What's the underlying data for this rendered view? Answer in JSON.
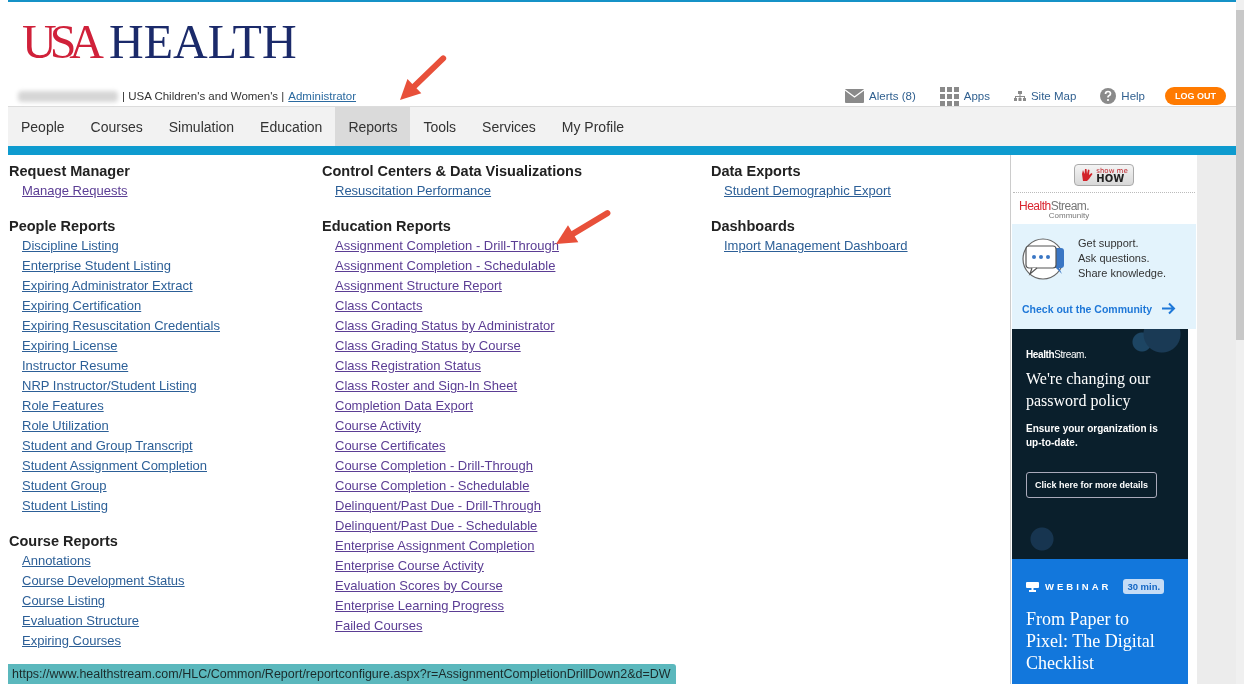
{
  "header": {
    "logo": {
      "mark": "USA",
      "word": "HEALTH"
    },
    "org_text": "| USA Children's and Women's |",
    "role_link": "Administrator",
    "utility_links": [
      {
        "kind": "alerts",
        "label": "Alerts (8)"
      },
      {
        "kind": "apps",
        "label": "Apps"
      },
      {
        "kind": "sitemap",
        "label": "Site Map"
      },
      {
        "kind": "help",
        "label": "Help"
      }
    ],
    "logout": "LOG OUT"
  },
  "nav": [
    {
      "label": "People",
      "selected": false
    },
    {
      "label": "Courses",
      "selected": false
    },
    {
      "label": "Simulation",
      "selected": false
    },
    {
      "label": "Education",
      "selected": false
    },
    {
      "label": "Reports",
      "selected": true
    },
    {
      "label": "Tools",
      "selected": false
    },
    {
      "label": "Services",
      "selected": false
    },
    {
      "label": "My Profile",
      "selected": false
    }
  ],
  "columns": [
    [
      {
        "heading": "Request Manager",
        "links": [
          {
            "label": "Manage Requests",
            "visited": true
          }
        ]
      },
      {
        "heading": "People Reports",
        "links": [
          {
            "label": "Discipline Listing",
            "visited": false
          },
          {
            "label": "Enterprise Student Listing",
            "visited": false
          },
          {
            "label": "Expiring Administrator Extract",
            "visited": false
          },
          {
            "label": "Expiring Certification",
            "visited": false
          },
          {
            "label": "Expiring Resuscitation Credentials",
            "visited": false
          },
          {
            "label": "Expiring License",
            "visited": false
          },
          {
            "label": "Instructor Resume",
            "visited": false
          },
          {
            "label": "NRP Instructor/Student Listing",
            "visited": false
          },
          {
            "label": "Role Features",
            "visited": false
          },
          {
            "label": "Role Utilization",
            "visited": false
          },
          {
            "label": "Student and Group Transcript",
            "visited": false
          },
          {
            "label": "Student Assignment Completion",
            "visited": false
          },
          {
            "label": "Student Group",
            "visited": false
          },
          {
            "label": "Student Listing",
            "visited": false
          }
        ]
      },
      {
        "heading": "Course Reports",
        "links": [
          {
            "label": "Annotations",
            "visited": false
          },
          {
            "label": "Course Development Status",
            "visited": false
          },
          {
            "label": "Course Listing",
            "visited": false
          },
          {
            "label": "Evaluation Structure",
            "visited": false
          },
          {
            "label": "Expiring Courses",
            "visited": false
          }
        ]
      }
    ],
    [
      {
        "heading": "Control Centers & Data Visualizations",
        "links": [
          {
            "label": "Resuscitation Performance",
            "visited": false
          }
        ]
      },
      {
        "heading": "Education Reports",
        "links": [
          {
            "label": "Assignment Completion - Drill-Through",
            "visited": true
          },
          {
            "label": "Assignment Completion - Schedulable",
            "visited": true
          },
          {
            "label": "Assignment Structure Report",
            "visited": true
          },
          {
            "label": "Class Contacts",
            "visited": true
          },
          {
            "label": "Class Grading Status by Administrator",
            "visited": true
          },
          {
            "label": "Class Grading Status by Course",
            "visited": true
          },
          {
            "label": "Class Registration Status",
            "visited": true
          },
          {
            "label": "Class Roster and Sign-In Sheet",
            "visited": true
          },
          {
            "label": "Completion Data Export",
            "visited": true
          },
          {
            "label": "Course Activity",
            "visited": true
          },
          {
            "label": "Course Certificates",
            "visited": true
          },
          {
            "label": "Course Completion - Drill-Through",
            "visited": true
          },
          {
            "label": "Course Completion - Schedulable",
            "visited": true
          },
          {
            "label": "Delinquent/Past Due - Drill-Through",
            "visited": true
          },
          {
            "label": "Delinquent/Past Due - Schedulable",
            "visited": true
          },
          {
            "label": "Enterprise Assignment Completion",
            "visited": true
          },
          {
            "label": "Enterprise Course Activity",
            "visited": true
          },
          {
            "label": "Evaluation Scores by Course",
            "visited": true
          },
          {
            "label": "Enterprise Learning Progress",
            "visited": true
          },
          {
            "label": "Failed Courses",
            "visited": true
          }
        ]
      }
    ],
    [
      {
        "heading": "Data Exports",
        "links": [
          {
            "label": "Student Demographic Export",
            "visited": false
          }
        ]
      },
      {
        "heading": "Dashboards",
        "links": [
          {
            "label": "Import Management Dashboard",
            "visited": false
          }
        ]
      }
    ]
  ],
  "sidebar": {
    "show_me_how": {
      "top": "show me",
      "bottom": "HOW"
    },
    "community": {
      "brand_a": "Health",
      "brand_b": "Stream.",
      "sub": "Community",
      "lines": [
        "Get support.",
        "Ask questions.",
        "Share knowledge."
      ],
      "link": "Check out the Community"
    },
    "password_card": {
      "brand_a": "Health",
      "brand_b": "Stream.",
      "title": "We're changing our password policy",
      "text": "Ensure your organization is up-to-date.",
      "button": "Click here for more details"
    },
    "webinar_card": {
      "tag": "WEBINAR",
      "duration": "30 min.",
      "title": "From Paper to Pixel: The Digital Checklist"
    }
  },
  "status_url": "https://www.healthstream.com/HLC/Common/Report/reportconfigure.aspx?r=AssignmentCompletionDrillDown2&d=DW"
}
